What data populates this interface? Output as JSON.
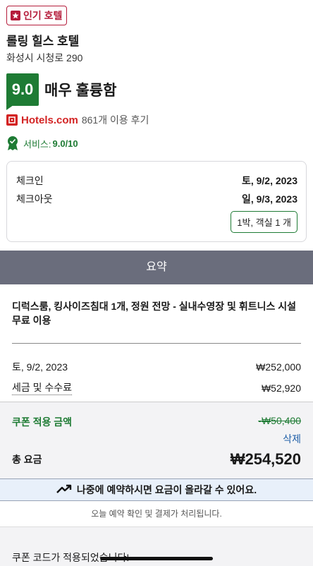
{
  "badge": {
    "label": "인기 호텔",
    "icon": "star-icon"
  },
  "hotel": {
    "name": "롤링 힐스 호텔",
    "address": "화성시 시청로 290"
  },
  "rating": {
    "score": "9.0",
    "label": "매우 훌륭함"
  },
  "reviews": {
    "brand": "Hotels.com",
    "count_text": "861개 이용 후기"
  },
  "service": {
    "label": "서비스:",
    "value": "9.0/10"
  },
  "stay": {
    "checkin_label": "체크인",
    "checkin_value": "토, 9/2, 2023",
    "checkout_label": "체크아웃",
    "checkout_value": "일, 9/3, 2023",
    "room_summary": "1박, 객실 1 개"
  },
  "summary": {
    "header": "요약",
    "room_desc": "디럭스룸, 킹사이즈침대 1개, 정원 전망 - 실내수영장 및 휘트니스 시설 무료 이용",
    "night_label": "토, 9/2, 2023",
    "night_price": "₩252,000",
    "tax_label": "세금 및 수수료",
    "tax_price": "₩52,920",
    "coupon_label": "쿠폰 적용 금액",
    "coupon_amount": "-₩50,400",
    "coupon_delete": "삭제",
    "total_label": "총 요금",
    "total_price": "₩254,520"
  },
  "alert": {
    "text": "나중에 예약하시면 요금이 올라갈 수 있어요.",
    "icon": "trending-up-icon"
  },
  "note": "오늘 예약 확인 및 결제가 처리됩니다.",
  "coupon_applied": "쿠폰 코드가 적용되었습니다!",
  "colors": {
    "accent": "#1e7b34",
    "brand_red": "#d32323",
    "badge_red": "#b51d3b",
    "header_gray": "#6a6d7c",
    "link_blue": "#1f5fa8"
  }
}
